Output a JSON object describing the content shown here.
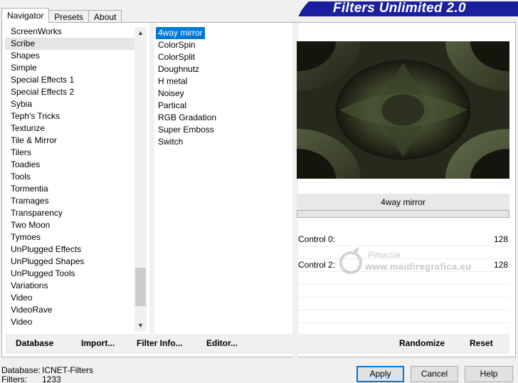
{
  "tabs": [
    "Navigator",
    "Presets",
    "About"
  ],
  "brand": {
    "title": "Filters Unlimited 2.0",
    "color": "#1a1f9e"
  },
  "categories": [
    "ScreenWorks",
    "Scribe",
    "Shapes",
    "Simple",
    "Special Effects 1",
    "Special Effects 2",
    "Sybia",
    "Teph's Tricks",
    "Texturize",
    "Tile & Mirror",
    "Tilers",
    "Toadies",
    "Tools",
    "Tormentia",
    "Tramages",
    "Transparency",
    "Two Moon",
    "Tymoes",
    "UnPlugged Effects",
    "UnPlugged Shapes",
    "UnPlugged Tools",
    "Variations",
    "Video",
    "VideoRave",
    "Video"
  ],
  "selected_category": "Scribe",
  "filters": [
    "4way mirror",
    "ColorSpin",
    "ColorSplit",
    "Doughnutz",
    "H metal",
    "Noisey",
    "Partical",
    "RGB Gradation",
    "Super Emboss",
    "Switch"
  ],
  "selected_filter": "4way mirror",
  "left_buttons": {
    "database": "Database",
    "import": "Import...",
    "filter_info": "Filter Info...",
    "editor": "Editor..."
  },
  "preview": {
    "filter_name": "4way mirror"
  },
  "controls": [
    {
      "label": "Control 0:",
      "value": "128"
    },
    {
      "label": "Control 2:",
      "value": "128"
    }
  ],
  "watermark": {
    "line1": "Pinuccia",
    "line2": "www.maidiregrafica.eu"
  },
  "right_buttons": {
    "randomize": "Randomize",
    "reset": "Reset"
  },
  "footer": {
    "database_label": "Database:",
    "database_value": "ICNET-Filters",
    "filters_label": "Filters:",
    "filters_value": "1233"
  },
  "dialog_buttons": {
    "apply": "Apply",
    "cancel": "Cancel",
    "help": "Help"
  },
  "colors": {
    "selection": "#0078d7",
    "panel_bg": "#f0f0f0"
  }
}
